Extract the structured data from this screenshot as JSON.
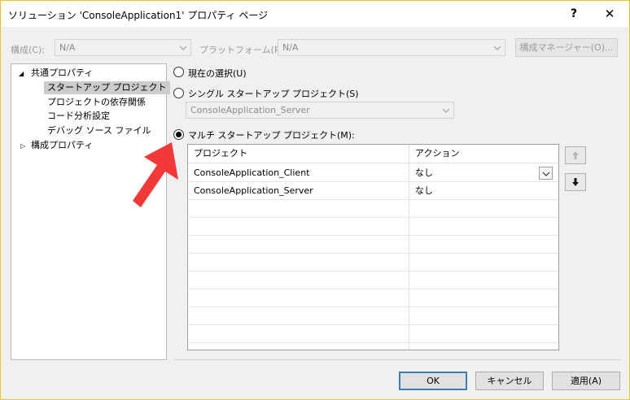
{
  "window": {
    "title": "ソリューション 'ConsoleApplication1' プロパティ ページ",
    "help_label": "?",
    "close_label": "✕"
  },
  "toolbar": {
    "config_label": "構成(C):",
    "config_value": "N/A",
    "platform_label": "プラットフォーム(P):",
    "platform_value": "N/A",
    "config_manager_label": "構成マネージャー(O)..."
  },
  "tree": {
    "common_props": "共通プロパティ",
    "items": [
      {
        "label": "スタートアップ プロジェクト"
      },
      {
        "label": "プロジェクトの依存関係"
      },
      {
        "label": "コード分析設定"
      },
      {
        "label": "デバッグ ソース ファイル"
      }
    ],
    "config_props": "構成プロパティ"
  },
  "options": {
    "current_selection": "現在の選択(U)",
    "single_startup": "シングル スタートアップ プロジェクト(S)",
    "single_startup_value": "ConsoleApplication_Server",
    "multi_startup": "マルチ スタートアップ プロジェクト(M):"
  },
  "grid": {
    "headers": [
      "プロジェクト",
      "アクション"
    ],
    "rows": [
      {
        "project": "ConsoleApplication_Client",
        "action": "なし"
      },
      {
        "project": "ConsoleApplication_Server",
        "action": "なし"
      }
    ]
  },
  "footer": {
    "ok_label": "OK",
    "cancel_label": "キャンセル",
    "apply_label": "適用(A)"
  },
  "colors": {
    "annotation_arrow": "#f23838",
    "window_border": "#e8c530",
    "default_button_border": "#3c7fb1"
  }
}
